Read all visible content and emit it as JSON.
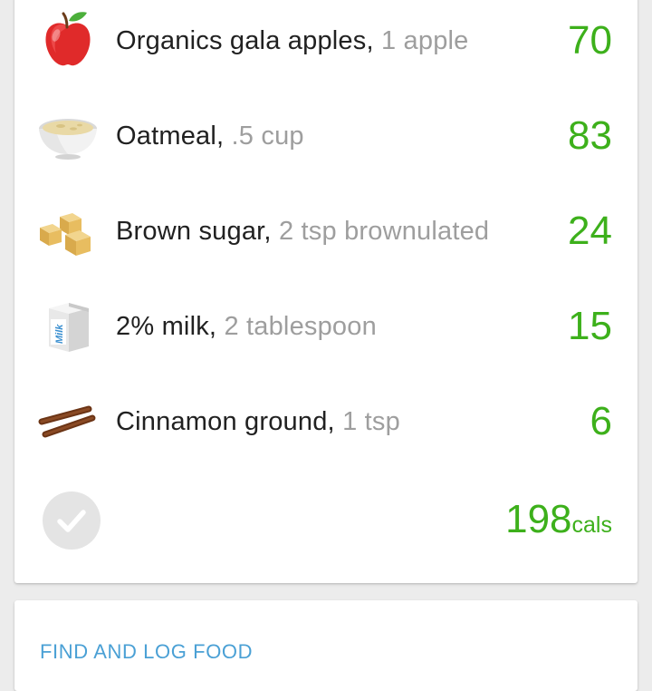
{
  "foods": [
    {
      "name": "Organics gala apples,",
      "serving": "1 apple",
      "calories": "70",
      "icon": "apple-icon"
    },
    {
      "name": "Oatmeal,",
      "serving": ".5 cup",
      "calories": "83",
      "icon": "oatmeal-bowl-icon"
    },
    {
      "name": "Brown sugar,",
      "serving": "2 tsp brownulated",
      "calories": "24",
      "icon": "sugar-cubes-icon"
    },
    {
      "name": "2% milk,",
      "serving": "2 tablespoon",
      "calories": "15",
      "icon": "milk-carton-icon"
    },
    {
      "name": "Cinnamon ground,",
      "serving": "1 tsp",
      "calories": "6",
      "icon": "cinnamon-sticks-icon"
    }
  ],
  "summary": {
    "total_calories": "198",
    "unit": "cals",
    "check_icon": "check-icon"
  },
  "milk_carton_label": "Milk",
  "find_food": {
    "label": "FIND AND LOG FOOD"
  },
  "colors": {
    "calorie_green": "#3db01b",
    "link_blue": "#4aa0d5",
    "secondary_text": "#9e9e9e",
    "primary_text": "#212121"
  }
}
